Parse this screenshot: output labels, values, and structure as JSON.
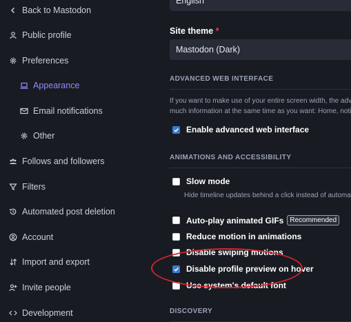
{
  "sidebar": {
    "back": "Back to Mastodon",
    "public_profile": "Public profile",
    "preferences": "Preferences",
    "appearance": "Appearance",
    "email_notifications": "Email notifications",
    "other": "Other",
    "follows": "Follows and followers",
    "filters": "Filters",
    "automated_deletion": "Automated post deletion",
    "account": "Account",
    "import_export": "Import and export",
    "invite_people": "Invite people",
    "development": "Development"
  },
  "form": {
    "language_value": "English",
    "site_theme_label": "Site theme",
    "required_mark": "*",
    "site_theme_value": "Mastodon (Dark)",
    "advanced_title": "ADVANCED WEB INTERFACE",
    "advanced_help_1": "If you want to make use of your entire screen width, the adva",
    "advanced_help_2": "much information at the same time as you want: Home, notifi",
    "enable_advanced": "Enable advanced web interface",
    "animations_title": "ANIMATIONS AND ACCESSIBILITY",
    "slow_mode": "Slow mode",
    "slow_mode_hint": "Hide timeline updates behind a click instead of automaticall",
    "autoplay_gifs": "Auto-play animated GIFs",
    "recommended": "Recommended",
    "reduce_motion": "Reduce motion in animations",
    "disable_swiping": "Disable swiping motions",
    "disable_profile_preview": "Disable profile preview on hover",
    "system_font": "Use system's default font",
    "discovery_title": "DISCOVERY"
  },
  "checkboxes": {
    "enable_advanced": true,
    "slow_mode": false,
    "autoplay_gifs": false,
    "reduce_motion": false,
    "disable_swiping": false,
    "disable_profile_preview": true,
    "system_font": false
  },
  "colors": {
    "background": "#191b22",
    "accent": "#8c8dff",
    "checkbox_on": "#3a7bd5",
    "annotation": "#d8242d",
    "required": "#df405a"
  }
}
